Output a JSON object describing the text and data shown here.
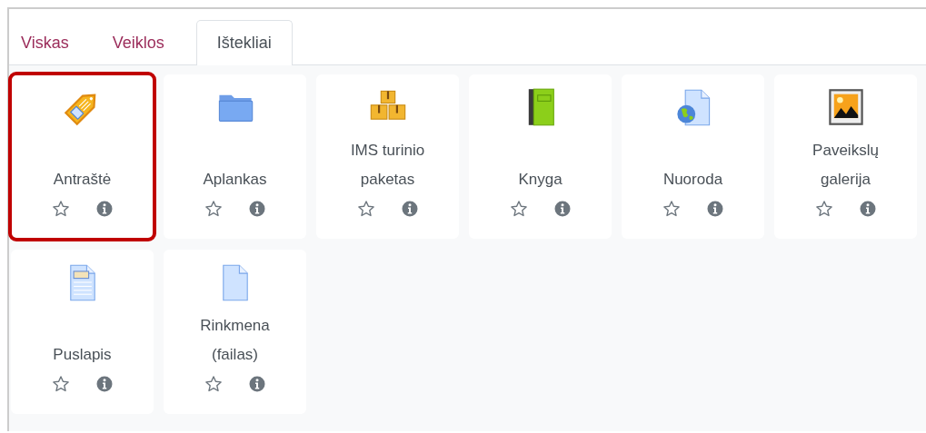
{
  "tabs": [
    {
      "label": "Viskas",
      "selected": false
    },
    {
      "label": "Veiklos",
      "selected": false
    },
    {
      "label": "Ištekliai",
      "selected": true
    }
  ],
  "items": [
    {
      "kind": "tag",
      "label": "Antraštė",
      "highlighted": true
    },
    {
      "kind": "folder",
      "label": "Aplankas",
      "highlighted": false
    },
    {
      "kind": "package",
      "label": "IMS turinio paketas",
      "highlighted": false
    },
    {
      "kind": "book",
      "label": "Knyga",
      "highlighted": false
    },
    {
      "kind": "url",
      "label": "Nuoroda",
      "highlighted": false
    },
    {
      "kind": "gallery",
      "label": "Paveikslų galerija",
      "highlighted": false
    },
    {
      "kind": "page",
      "label": "Puslapis",
      "highlighted": false
    },
    {
      "kind": "file",
      "label": "Rinkmena (failas)",
      "highlighted": false
    }
  ]
}
